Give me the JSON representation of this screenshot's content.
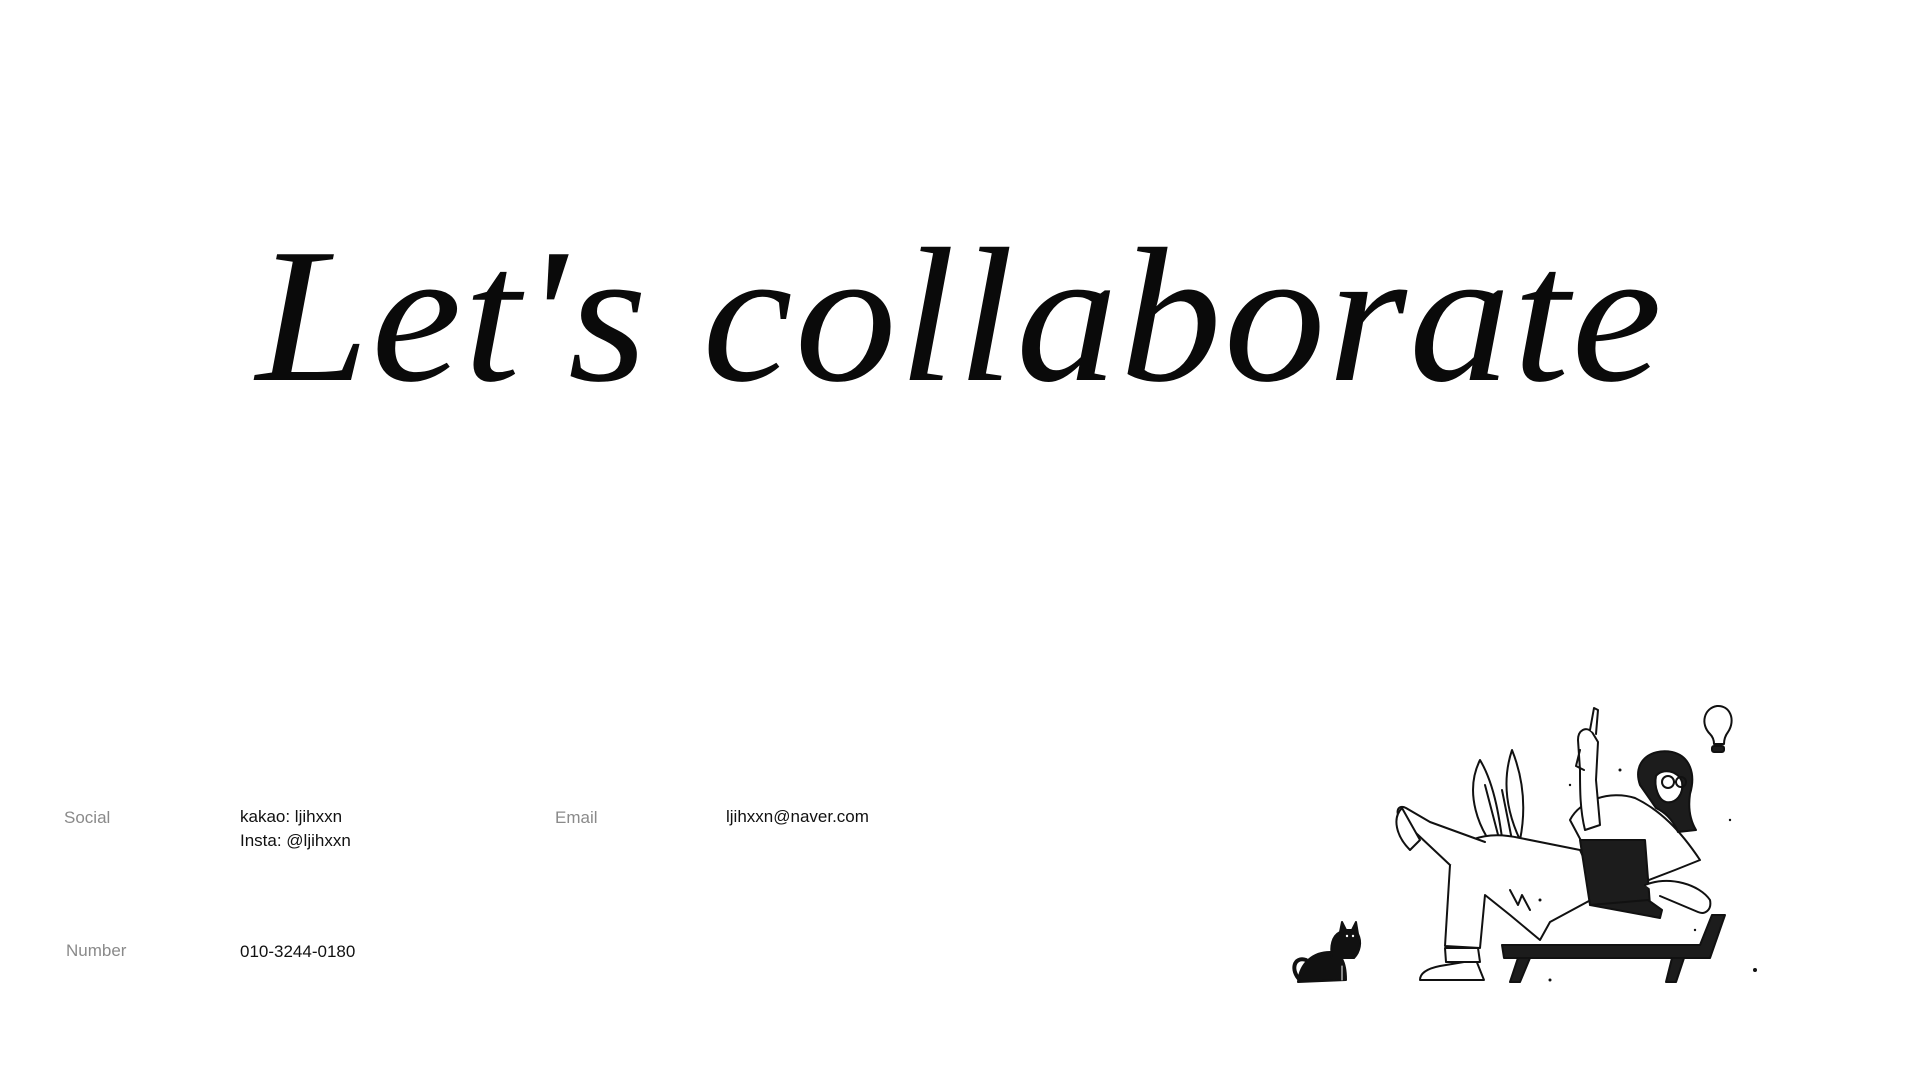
{
  "headline": "Let's collaborate",
  "contact": {
    "social": {
      "label": "Social",
      "lines": [
        "kakao: ljihxxn",
        "Insta: @ljihxxn"
      ]
    },
    "email": {
      "label": "Email",
      "value": "ljihxxn@naver.com"
    },
    "number": {
      "label": "Number",
      "value": "010-3244-0180"
    }
  },
  "illustration": {
    "icon": "person-relaxing-with-laptop-and-cat-illustration"
  },
  "colors": {
    "background": "#ffffff",
    "text": "#111111",
    "label": "#8a8a8a"
  }
}
